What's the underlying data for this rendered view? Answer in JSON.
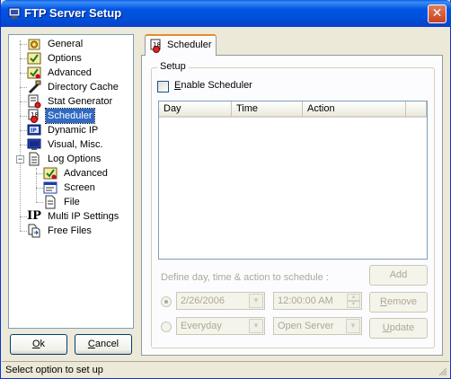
{
  "window": {
    "title": "FTP Server Setup",
    "close_glyph": "✕"
  },
  "tree": {
    "items": [
      {
        "label": "General",
        "icon": "general-icon"
      },
      {
        "label": "Options",
        "icon": "options-icon"
      },
      {
        "label": "Advanced",
        "icon": "advanced-icon"
      },
      {
        "label": "Directory Cache",
        "icon": "directory-cache-icon"
      },
      {
        "label": "Stat Generator",
        "icon": "stat-generator-icon"
      },
      {
        "label": "Scheduler",
        "icon": "scheduler-icon",
        "selected": true
      },
      {
        "label": "Dynamic IP",
        "icon": "dynamic-ip-icon"
      },
      {
        "label": "Visual, Misc.",
        "icon": "monitor-icon"
      },
      {
        "label": "Log Options",
        "icon": "log-options-icon"
      },
      {
        "label": "Advanced",
        "icon": "advanced-icon"
      },
      {
        "label": "Screen",
        "icon": "screen-icon"
      },
      {
        "label": "File",
        "icon": "file-icon"
      },
      {
        "label": "Multi IP Settings",
        "icon": "multi-ip-icon"
      },
      {
        "label": "Free Files",
        "icon": "free-files-icon"
      }
    ],
    "ip_glyph": "IP"
  },
  "buttons": {
    "ok": "Ok",
    "ok_key": "O",
    "cancel": "Cancel",
    "cancel_key": "C"
  },
  "tab": {
    "label": "Scheduler"
  },
  "setup": {
    "group_title": "Setup",
    "enable_label": "Enable Scheduler",
    "enable_key": "E",
    "enable_checked": false,
    "columns": [
      "Day",
      "Time",
      "Action"
    ]
  },
  "schedule": {
    "hint": "Define day, time & action to schedule :",
    "date_value": "2/26/2006",
    "time_value": "12:00:00 AM",
    "repeat_value": "Everyday",
    "action_value": "Open Server",
    "add_label": "Add",
    "remove_label": "Remove",
    "remove_key": "R",
    "update_label": "Update",
    "update_key": "U"
  },
  "status": {
    "text": "Select option to set up"
  },
  "colors": {
    "title_blue": "#0054e3",
    "selection": "#316ac5",
    "tab_highlight": "#e68b2c",
    "window_bg": "#ece9d8"
  }
}
